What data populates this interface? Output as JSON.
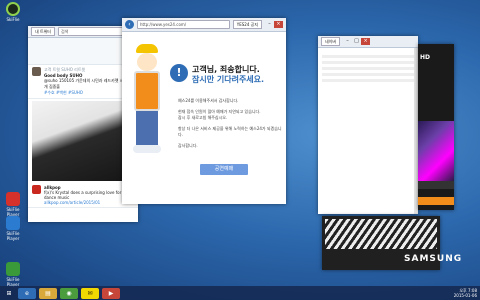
{
  "desktop_icons": [
    {
      "label": "SkiFlie",
      "icon": "app-icon"
    },
    {
      "label": "SkiFlie Player",
      "icon": "media-player-icon"
    },
    {
      "label": "SkiFlie Player",
      "icon": "media-player-icon"
    },
    {
      "label": "SkiFlie Player",
      "icon": "media-player-icon"
    }
  ],
  "twitter": {
    "tab_label": "내 트위터",
    "search_placeholder": "검색",
    "retweet_line": "고객 트윗 SUHO 리트윗",
    "tweet_author": "Good body SUHO",
    "tweet_text": "@suho 150105 가운데의 시민과 레드카펫 사진 공개 집중출",
    "tweet_link": "#수호 #백현 #SUHO",
    "second_author": "allkpop",
    "second_text": "f(x)'s Krystal does a surprising love for dance music",
    "second_link": "allkpop.com/article/2015/01"
  },
  "main_browser": {
    "url": "http://www.yes24.com/",
    "tab_label": "YES24 공지",
    "notice_title": "고객님, 죄송합니다.",
    "notice_sub": "잠시만 기다려주세요.",
    "body_lines": [
      "예스24를 이용해주셔서 감사합니다.",
      "현재 접속 인원이 많아 예매가 지연되고 있습니다.",
      "잠시 후 새로고침 해주십시오.",
      "항상 더 나은 서비스 제공을 위해 노력하는 예스24가 되겠습니다.",
      "감사합니다."
    ],
    "button_label": "공연예매"
  },
  "right_browser": {
    "tab_label": "네이버",
    "badge": "HD"
  },
  "samsung_window": {
    "brand": "SAMSUNG"
  },
  "taskbar": {
    "time": "오후 7:08",
    "date": "2015-01-06"
  },
  "colors": {
    "accent_blue": "#2e6db5",
    "button_blue": "#6e9be0",
    "close_red": "#c7463a",
    "orange": "#f28c1b"
  }
}
